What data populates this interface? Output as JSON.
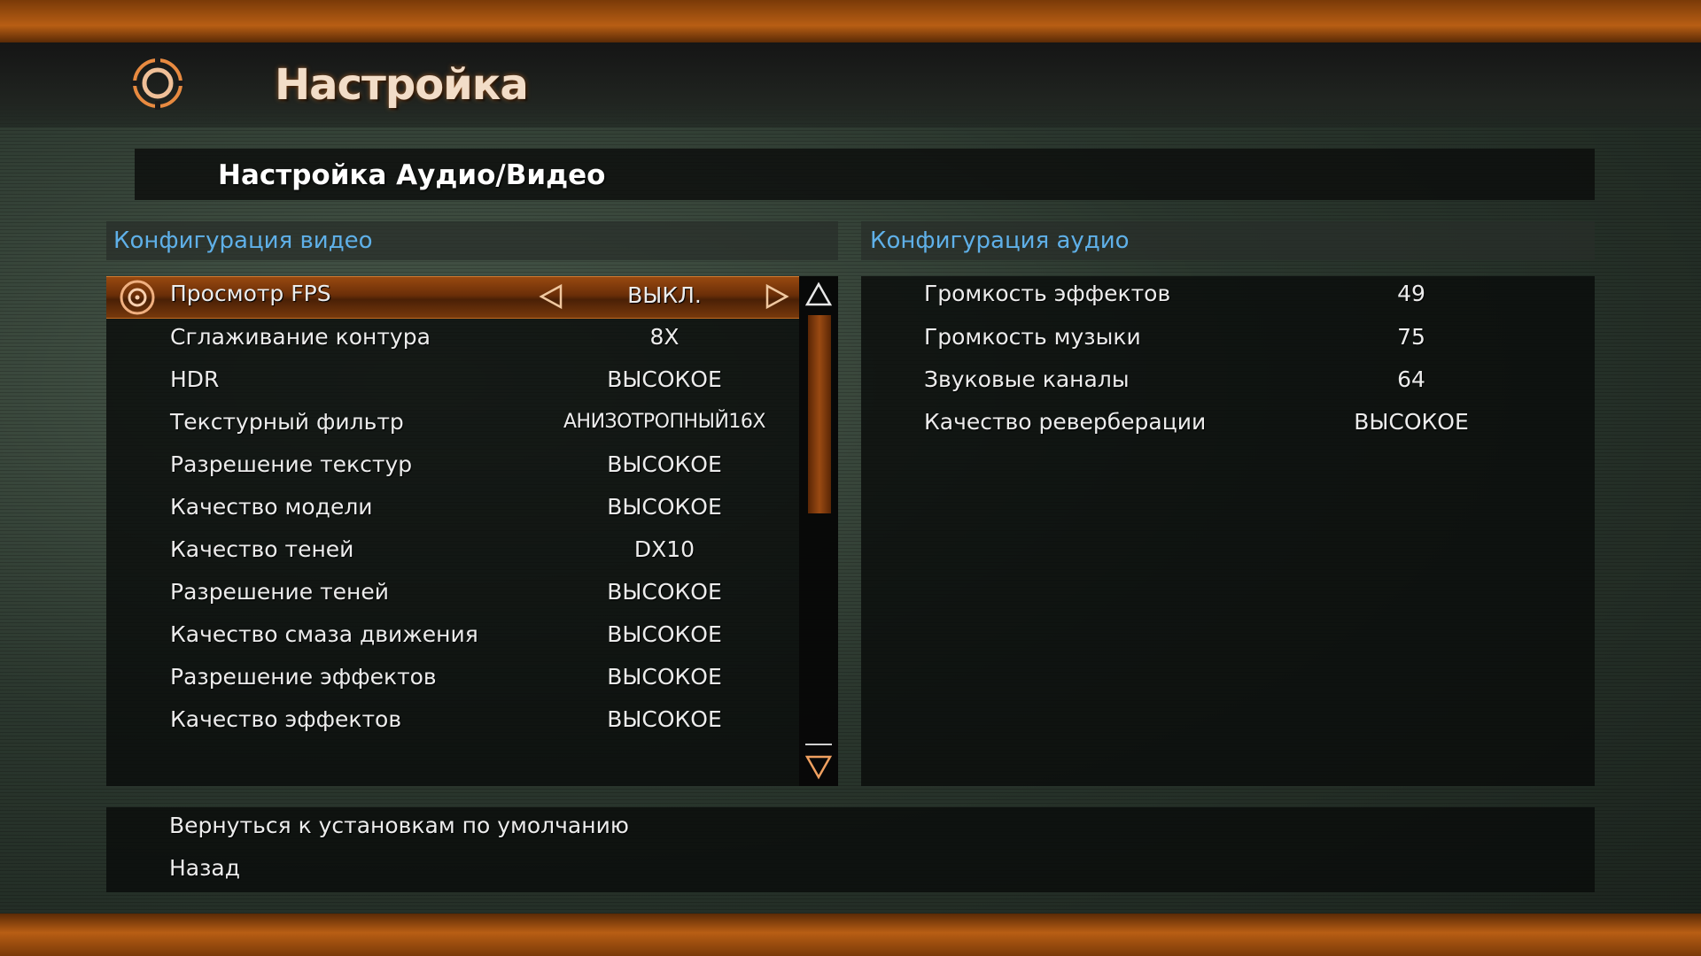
{
  "header": {
    "title": "Настройка",
    "subtitle": "Настройка Аудио/Видео"
  },
  "video": {
    "header": "Конфигурация видео",
    "items": [
      {
        "label": "Просмотр FPS",
        "value": "ВЫКЛ."
      },
      {
        "label": "Сглаживание контура",
        "value": "8X"
      },
      {
        "label": "HDR",
        "value": "ВЫСОКОЕ"
      },
      {
        "label": "Текстурный фильтр",
        "value": "АНИЗОТРОПНЫЙ16X"
      },
      {
        "label": "Разрешение текстур",
        "value": "ВЫСОКОЕ"
      },
      {
        "label": "Качество модели",
        "value": "ВЫСОКОЕ"
      },
      {
        "label": "Качество теней",
        "value": "DX10"
      },
      {
        "label": "Разрешение теней",
        "value": "ВЫСОКОЕ"
      },
      {
        "label": "Качество смаза движения",
        "value": "ВЫСОКОЕ"
      },
      {
        "label": "Разрешение эффектов",
        "value": "ВЫСОКОЕ"
      },
      {
        "label": "Качество эффектов",
        "value": "ВЫСОКОЕ"
      }
    ]
  },
  "audio": {
    "header": "Конфигурация аудио",
    "items": [
      {
        "label": "Громкость эффектов",
        "value": "49"
      },
      {
        "label": "Громкость музыки",
        "value": "75"
      },
      {
        "label": "Звуковые каналы",
        "value": "64"
      },
      {
        "label": "Качество реверберации",
        "value": "ВЫСОКОЕ"
      }
    ]
  },
  "footer": {
    "reset": "Вернуться к установкам по умолчанию",
    "back": "Назад"
  },
  "colors": {
    "accent_orange": "#b85e14",
    "header_blue": "#5fb0e8",
    "text": "#ececec"
  },
  "icons": {
    "logo": "target-reticle-icon",
    "selected": "target-reticle-icon",
    "left": "arrow-left-icon",
    "right": "arrow-right-icon",
    "scroll_up": "scroll-up-icon",
    "scroll_down": "scroll-down-icon"
  }
}
